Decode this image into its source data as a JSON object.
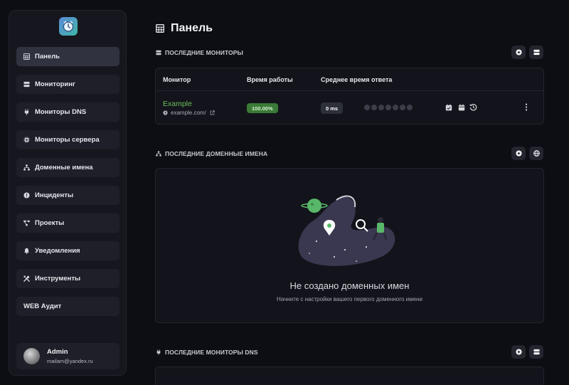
{
  "sidebar": {
    "items": [
      {
        "label": "Панель",
        "icon": "table-icon"
      },
      {
        "label": "Мониторинг",
        "icon": "server-icon"
      },
      {
        "label": "Мониторы DNS",
        "icon": "plug-icon"
      },
      {
        "label": "Мониторы сервера",
        "icon": "cpu-icon"
      },
      {
        "label": "Доменные имена",
        "icon": "sitemap-icon"
      },
      {
        "label": "Инциденты",
        "icon": "alert-circle-icon"
      },
      {
        "label": "Проекты",
        "icon": "project-diagram-icon"
      },
      {
        "label": "Уведомления",
        "icon": "bell-icon"
      },
      {
        "label": "Инструменты",
        "icon": "tools-icon"
      },
      {
        "label": "WEB Аудит",
        "icon": ""
      }
    ],
    "user": {
      "name": "Admin",
      "email": "mailam@yandex.ru"
    }
  },
  "page": {
    "title": "Панель"
  },
  "monitors": {
    "heading": "ПОСЛЕДНИЕ МОНИТОРЫ",
    "columns": [
      "Монитор",
      "Время работы",
      "Среднее время ответа"
    ],
    "rows": [
      {
        "name": "Example",
        "url": "example.com/",
        "uptime": "100.00%",
        "response": "0 ms"
      }
    ]
  },
  "domains": {
    "heading": "ПОСЛЕДНИЕ ДОМЕННЫЕ ИМЕНА",
    "empty_title": "Не создано доменных имен",
    "empty_subtitle": "Начните с настройки вашего первого доменного имени"
  },
  "dns": {
    "heading": "ПОСЛЕДНИЕ МОНИТОРЫ DNS"
  },
  "colors": {
    "accent_green": "#6dbf5c",
    "badge_green": "#3a7a36",
    "background": "#0d0e13"
  }
}
